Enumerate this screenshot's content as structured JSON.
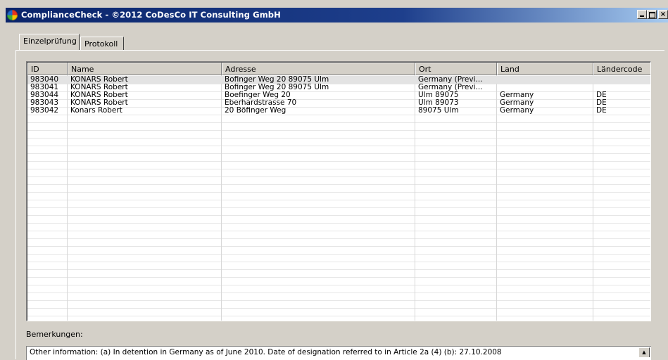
{
  "window": {
    "title": "ComplianceCheck - ©2012 CoDesCo IT Consulting GmbH",
    "icon": "app-logo-icon",
    "accent": "#0a246a"
  },
  "tabs": [
    {
      "label": "Einzelprüfung",
      "active": true
    },
    {
      "label": "Protokoll",
      "active": false
    }
  ],
  "table": {
    "columns": [
      "ID",
      "Name",
      "Adresse",
      "Ort",
      "Land",
      "Ländercode"
    ],
    "rows": [
      [
        "983040",
        "KONARS Robert",
        "Bofinger Weg 20 89075 Ulm",
        "Germany (Previ...",
        "",
        ""
      ],
      [
        "983041",
        "KONARS Robert",
        "Bofinger Weg 20 89075 Ulm",
        "Germany (Previ...",
        "",
        ""
      ],
      [
        "983044",
        "KONARS Robert",
        "Boefinger Weg 20",
        "Ulm  89075",
        "Germany",
        "DE"
      ],
      [
        "983043",
        "KONARS Robert",
        "Eberhardstrasse 70",
        "Ulm  89073",
        "Germany",
        "DE"
      ],
      [
        "983042",
        "Konars Robert",
        "20 Böfinger Weg",
        "89075 Ulm",
        "Germany",
        "DE"
      ]
    ]
  },
  "remarks": {
    "label": "Bemerkungen:",
    "text": "Other information: (a) In detention in Germany as of June 2010. Date of designation referred to in Article 2a (4) (b): 27.10.2008"
  }
}
